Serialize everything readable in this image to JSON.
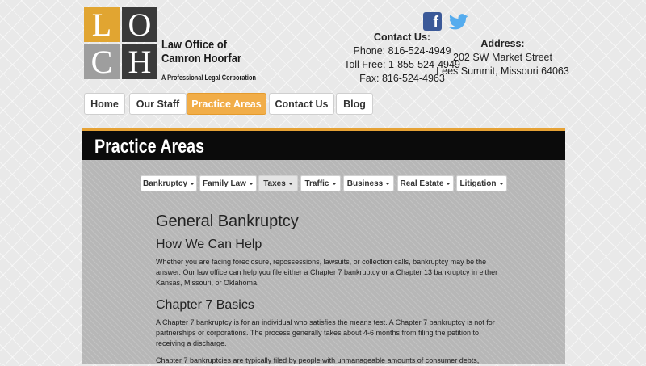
{
  "logo": {
    "letters": [
      "L",
      "O",
      "C",
      "H"
    ],
    "name_line1": "Law Office of",
    "name_line2": "Camron Hoorfar",
    "tagline": "A Professional Legal Corporation"
  },
  "social": {
    "facebook_icon": "facebook-icon",
    "twitter_icon": "twitter-icon",
    "facebook_glyph": "f"
  },
  "contact": {
    "heading": "Contact Us:",
    "phone": "Phone: 816-524-4949",
    "toll_free": "Toll Free: 1-855-524-4949",
    "fax": "Fax: 816-524-4963"
  },
  "address": {
    "heading": "Address:",
    "line1": "202 SW Market Street",
    "line2": "Lees Summit, Missouri 64063"
  },
  "nav": [
    {
      "label": "Home"
    },
    {
      "label": "Our Staff"
    },
    {
      "label": "Practice Areas",
      "active": true
    },
    {
      "label": "Contact Us"
    },
    {
      "label": "Blog"
    }
  ],
  "banner": {
    "title": "Practice Areas"
  },
  "tabs": [
    {
      "label": "Bankruptcy"
    },
    {
      "label": "Family Law"
    },
    {
      "label": "Taxes",
      "selected": true
    },
    {
      "label": "Traffic"
    },
    {
      "label": "Business"
    },
    {
      "label": "Real Estate"
    },
    {
      "label": "Litigation"
    }
  ],
  "article": {
    "title": "General Bankruptcy",
    "sections": [
      {
        "heading": "How We Can Help",
        "paragraphs": [
          "Whether you are facing foreclosure, repossessions, lawsuits, or collection calls, bankruptcy may be the answer. Our law office can help you file either a Chapter 7 bankruptcy or a Chapter 13 bankruptcy in either Kansas, Missouri, or Oklahoma."
        ]
      },
      {
        "heading": "Chapter 7 Basics",
        "paragraphs": [
          "A Chapter 7 bankruptcy is for an individual who satisfies the means test. A Chapter 7 bankruptcy is not for partnerships or corporations. The process generally takes about 4-6 months from filing the petition to receiving a discharge.",
          "Chapter 7 bankruptcies are typically filed by people with unmanageable amounts of consumer debts,"
        ]
      }
    ]
  },
  "colors": {
    "accent": "#f1ad48",
    "banner_bg": "#0b0b0b",
    "facebook": "#3b5998",
    "twitter": "#55acee"
  }
}
